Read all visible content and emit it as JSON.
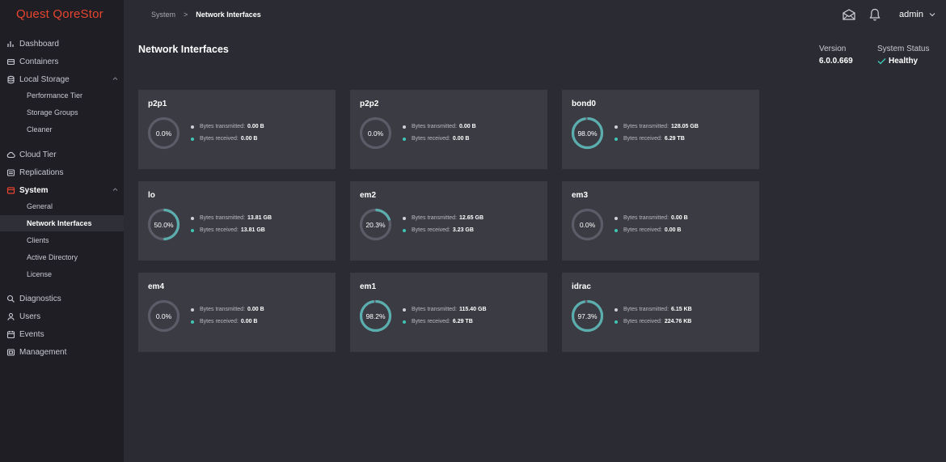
{
  "app": {
    "brand_part1": "Quest",
    "brand_part2": "QoreStor"
  },
  "topbar": {
    "breadcrumb": [
      "System",
      "Network Interfaces"
    ],
    "breadcrumb_sep": ">",
    "user": "admin",
    "icons": [
      "mail-icon",
      "bell-icon"
    ]
  },
  "sidebar": {
    "items": [
      {
        "label": "Dashboard",
        "icon": "bar-chart-icon"
      },
      {
        "label": "Containers",
        "icon": "container-icon"
      },
      {
        "label": "Local Storage",
        "icon": "database-icon",
        "expanded": true,
        "children": [
          "Performance Tier",
          "Storage Groups",
          "Cleaner"
        ]
      },
      {
        "label": "Cloud Tier",
        "icon": "cloud-icon"
      },
      {
        "label": "Replications",
        "icon": "replication-icon"
      },
      {
        "label": "System",
        "icon": "system-icon",
        "expanded": true,
        "active": true,
        "children": [
          "General",
          "Network Interfaces",
          "Clients",
          "Active Directory",
          "License"
        ],
        "active_child": "Network Interfaces"
      },
      {
        "label": "Diagnostics",
        "icon": "diagnostics-icon"
      },
      {
        "label": "Users",
        "icon": "user-icon"
      },
      {
        "label": "Events",
        "icon": "events-icon"
      },
      {
        "label": "Management",
        "icon": "management-icon"
      }
    ]
  },
  "main": {
    "title": "Network Interfaces",
    "version_label": "Version",
    "version_value": "6.0.0.669",
    "status_label": "System Status",
    "status_value": "Healthy",
    "tx_label": "Bytes transmitted:",
    "rx_label": "Bytes received:",
    "interfaces": [
      {
        "name": "p2p1",
        "percent_label": "0.0%",
        "percent": 0.0,
        "tx": "0.00 B",
        "rx": "0.00 B"
      },
      {
        "name": "p2p2",
        "percent_label": "0.0%",
        "percent": 0.0,
        "tx": "0.00 B",
        "rx": "0.00 B"
      },
      {
        "name": "bond0",
        "percent_label": "98.0%",
        "percent": 98.0,
        "tx": "128.05 GB",
        "rx": "6.29 TB"
      },
      {
        "name": "lo",
        "percent_label": "50.0%",
        "percent": 50.0,
        "tx": "13.81 GB",
        "rx": "13.81 GB"
      },
      {
        "name": "em2",
        "percent_label": "20.3%",
        "percent": 20.3,
        "tx": "12.65 GB",
        "rx": "3.23 GB"
      },
      {
        "name": "em3",
        "percent_label": "0.0%",
        "percent": 0.0,
        "tx": "0.00 B",
        "rx": "0.00 B"
      },
      {
        "name": "em4",
        "percent_label": "0.0%",
        "percent": 0.0,
        "tx": "0.00 B",
        "rx": "0.00 B"
      },
      {
        "name": "em1",
        "percent_label": "98.2%",
        "percent": 98.2,
        "tx": "115.40 GB",
        "rx": "6.29 TB"
      },
      {
        "name": "idrac",
        "percent_label": "97.3%",
        "percent": 97.3,
        "tx": "6.15 KB",
        "rx": "224.76 KB"
      }
    ]
  },
  "colors": {
    "accent": "#e8452f",
    "teal": "#5aaeae",
    "track": "#5c5c68",
    "tx_dot": "#d0d0d8",
    "rx_dot": "#3ec6b5",
    "card_bg": "#3b3b44",
    "page_bg": "#2b2b34",
    "sidebar_bg": "#1e1e24"
  }
}
